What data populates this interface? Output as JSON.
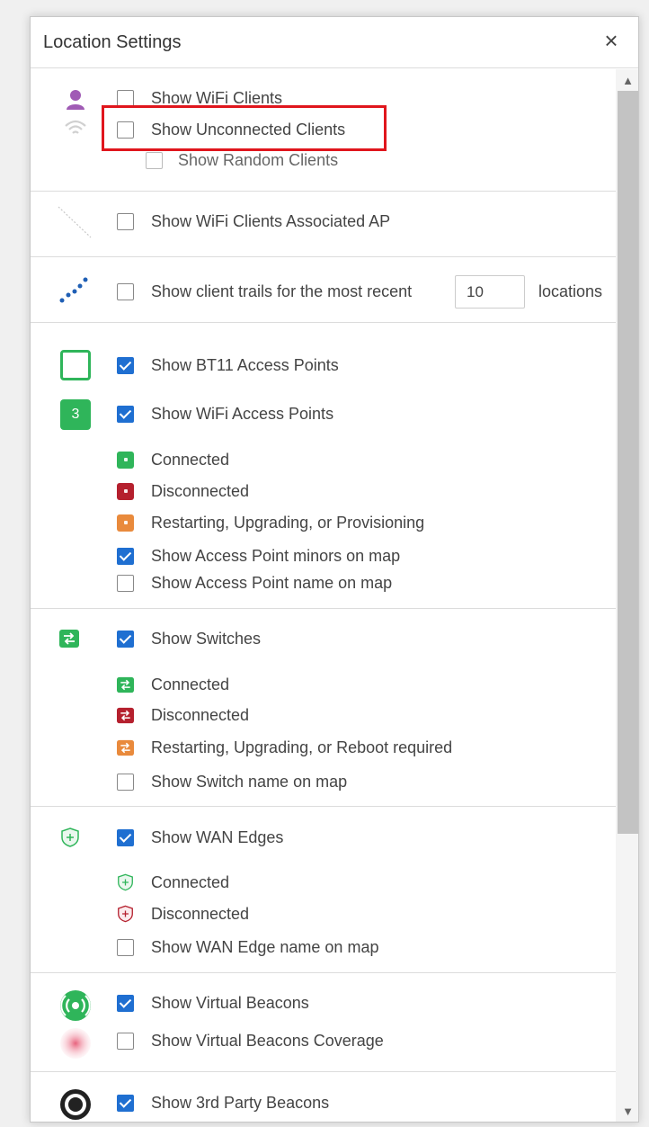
{
  "dialog": {
    "title": "Location Settings",
    "close_symbol": "×"
  },
  "clients": {
    "show_wifi_clients": {
      "label": "Show WiFi Clients",
      "checked": false
    },
    "show_unconnected_clients": {
      "label": "Show Unconnected Clients",
      "checked": false
    },
    "show_random_clients": {
      "label": "Show Random Clients",
      "checked": false
    }
  },
  "associated": {
    "show_wifi_clients_associated_ap": {
      "label": "Show WiFi Clients Associated AP",
      "checked": false
    }
  },
  "trails": {
    "label": "Show client trails for the most recent",
    "value": "10",
    "suffix": "locations",
    "checked": false
  },
  "access_points": {
    "show_bt11": {
      "label": "Show BT11 Access Points",
      "checked": true
    },
    "wifi_ap_count": "3",
    "show_wifi_ap": {
      "label": "Show WiFi Access Points",
      "checked": true
    },
    "legend": {
      "connected": "Connected",
      "disconnected": "Disconnected",
      "restarting": "Restarting, Upgrading, or Provisioning"
    },
    "show_minors": {
      "label": "Show Access Point minors on map",
      "checked": true
    },
    "show_name": {
      "label": "Show Access Point name on map",
      "checked": false
    }
  },
  "switches": {
    "show_switches": {
      "label": "Show Switches",
      "checked": true
    },
    "legend": {
      "connected": "Connected",
      "disconnected": "Disconnected",
      "restarting": "Restarting, Upgrading, or Reboot required"
    },
    "show_name": {
      "label": "Show Switch name on map",
      "checked": false
    }
  },
  "wan_edges": {
    "show_wan_edges": {
      "label": "Show WAN Edges",
      "checked": true
    },
    "legend": {
      "connected": "Connected",
      "disconnected": "Disconnected"
    },
    "show_name": {
      "label": "Show WAN Edge name on map",
      "checked": false
    }
  },
  "beacons": {
    "show_virtual_beacons": {
      "label": "Show Virtual Beacons",
      "checked": true
    },
    "show_virtual_beacons_coverage": {
      "label": "Show Virtual Beacons Coverage",
      "checked": false
    },
    "show_3rd_party_beacons": {
      "label": "Show 3rd Party Beacons",
      "checked": true
    }
  },
  "colors": {
    "connected": "#2fb55a",
    "disconnected": "#b5202e",
    "restarting": "#e98a3c",
    "checkbox_checked": "#1f6fd1",
    "highlight": "#e0161d"
  }
}
